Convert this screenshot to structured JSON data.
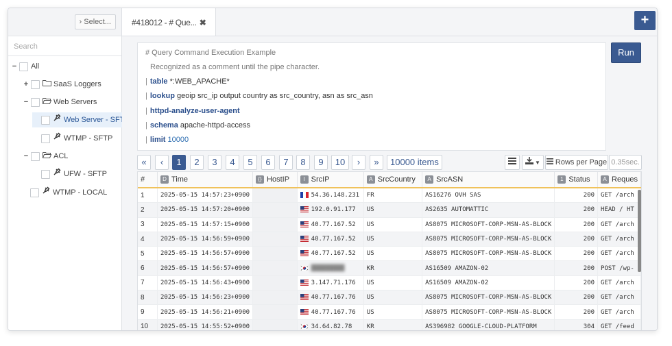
{
  "sidebar": {
    "select_label": "› Select...",
    "search_placeholder": "Search",
    "tree": [
      {
        "label": "All",
        "toggle": "−"
      },
      {
        "label": "SaaS Loggers",
        "toggle": "+"
      },
      {
        "label": "Web Servers",
        "toggle": "−"
      },
      {
        "label": "Web Server - SFTP",
        "toggle": ""
      },
      {
        "label": "WTMP - SFTP",
        "toggle": ""
      },
      {
        "label": "ACL",
        "toggle": "−"
      },
      {
        "label": "UFW - SFTP",
        "toggle": ""
      },
      {
        "label": "WTMP - LOCAL",
        "toggle": ""
      }
    ]
  },
  "tab": {
    "label": "#418012 - # Que...",
    "close": "✖"
  },
  "add_label": "+",
  "query": {
    "comment1": "# Query Command Execution Example",
    "comment2": "Recognized as a comment until the pipe character.",
    "lines": [
      {
        "kw": "table",
        "rest": "*:WEB_APACHE*"
      },
      {
        "kw": "lookup",
        "rest": "geoip src_ip output country as src_country, asn as src_asn"
      },
      {
        "kw": "httpd-analyze-user-agent",
        "rest": ""
      },
      {
        "kw": "schema",
        "rest": "apache-httpd-access"
      },
      {
        "kw": "limit",
        "rest": "10000"
      }
    ],
    "pipe": "|"
  },
  "run_label": "Run",
  "pager": {
    "first": "«",
    "prev": "‹",
    "next": "›",
    "last": "»",
    "pages": [
      "1",
      "2",
      "3",
      "4",
      "5",
      "6",
      "7",
      "8",
      "9",
      "10"
    ],
    "items": "10000 items"
  },
  "tools": {
    "rows_per_page": "Rows per Page",
    "elapsed": "0.35sec."
  },
  "table": {
    "columns": [
      {
        "label": "#",
        "badge": ""
      },
      {
        "label": "Time",
        "badge": "D"
      },
      {
        "label": "HostIP",
        "badge": "{}"
      },
      {
        "label": "SrcIP",
        "badge": "I"
      },
      {
        "label": "SrcCountry",
        "badge": "A"
      },
      {
        "label": "SrcASN",
        "badge": "A"
      },
      {
        "label": "Status",
        "badge": "1"
      },
      {
        "label": "Reques",
        "badge": "A"
      }
    ],
    "rows": [
      {
        "n": "1",
        "time": "2025-05-15 14:57:23+0900",
        "ip": "54.36.148.231",
        "flag": "fr",
        "country": "FR",
        "asn": "AS16276 OVH SAS",
        "status": "200",
        "req": "GET /arch"
      },
      {
        "n": "2",
        "time": "2025-05-15 14:57:20+0900",
        "ip": "192.0.91.177",
        "flag": "us",
        "country": "US",
        "asn": "AS2635 AUTOMATTIC",
        "status": "200",
        "req": "HEAD / HT"
      },
      {
        "n": "3",
        "time": "2025-05-15 14:57:15+0900",
        "ip": "40.77.167.52",
        "flag": "us",
        "country": "US",
        "asn": "AS8075 MICROSOFT-CORP-MSN-AS-BLOCK",
        "status": "200",
        "req": "GET /arch"
      },
      {
        "n": "4",
        "time": "2025-05-15 14:56:59+0900",
        "ip": "40.77.167.52",
        "flag": "us",
        "country": "US",
        "asn": "AS8075 MICROSOFT-CORP-MSN-AS-BLOCK",
        "status": "200",
        "req": "GET /arch"
      },
      {
        "n": "5",
        "time": "2025-05-15 14:56:57+0900",
        "ip": "40.77.167.52",
        "flag": "us",
        "country": "US",
        "asn": "AS8075 MICROSOFT-CORP-MSN-AS-BLOCK",
        "status": "200",
        "req": "GET /arch"
      },
      {
        "n": "6",
        "time": "2025-05-15 14:56:57+0900",
        "ip": "",
        "flag": "kr",
        "country": "KR",
        "asn": "AS16509 AMAZON-02",
        "status": "200",
        "req": "POST /wp-"
      },
      {
        "n": "7",
        "time": "2025-05-15 14:56:43+0900",
        "ip": "3.147.71.176",
        "flag": "us",
        "country": "US",
        "asn": "AS16509 AMAZON-02",
        "status": "200",
        "req": "GET /arch"
      },
      {
        "n": "8",
        "time": "2025-05-15 14:56:23+0900",
        "ip": "40.77.167.76",
        "flag": "us",
        "country": "US",
        "asn": "AS8075 MICROSOFT-CORP-MSN-AS-BLOCK",
        "status": "200",
        "req": "GET /arch"
      },
      {
        "n": "9",
        "time": "2025-05-15 14:56:21+0900",
        "ip": "40.77.167.76",
        "flag": "us",
        "country": "US",
        "asn": "AS8075 MICROSOFT-CORP-MSN-AS-BLOCK",
        "status": "200",
        "req": "GET /arch"
      },
      {
        "n": "10",
        "time": "2025-05-15 14:55:52+0900",
        "ip": "34.64.82.78",
        "flag": "kr",
        "country": "KR",
        "asn": "AS396982 GOOGLE-CLOUD-PLATFORM",
        "status": "304",
        "req": "GET /feed"
      }
    ]
  },
  "colors": {
    "accent": "#3a5a91",
    "header_underline": "#f0c25b"
  }
}
